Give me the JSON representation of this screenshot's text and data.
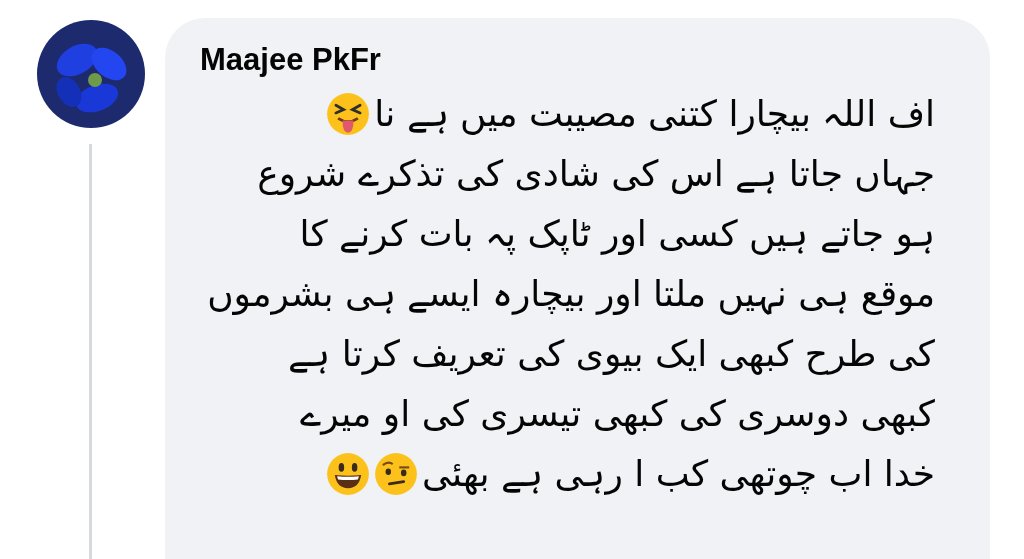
{
  "comment": {
    "author": "Maajee PkFr",
    "lines": [
      {
        "text": "اف اللہ بیچارا کتنی مصیبت میں ہے نا",
        "emojis": [
          {
            "kind": "squint-tongue"
          }
        ]
      },
      {
        "text": "جہاں جاتا ہے اس کی شادی کی تذکرے شروع"
      },
      {
        "text": "ہو جاتے ہیں کسی اور ٹاپک پہ بات کرنے کا"
      },
      {
        "text": "موقع ہی نہیں ملتا اور بیچارہ ایسے ہی بشرموں"
      },
      {
        "text": "کی طرح کبھی ایک بیوی کی تعریف کرتا ہے"
      },
      {
        "text": "کبھی دوسری کی کبھی تیسری کی او میرے"
      },
      {
        "text": "خدا اب چوتھی کب ا رہی ہے بھئی",
        "emojis": [
          {
            "kind": "raised-eyebrow"
          },
          {
            "kind": "grin"
          }
        ]
      }
    ]
  }
}
